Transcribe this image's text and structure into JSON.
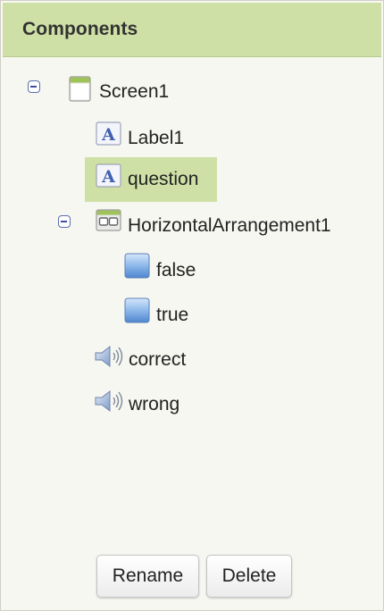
{
  "panel": {
    "title": "Components"
  },
  "tree": {
    "screen": {
      "label": "Screen1",
      "icon": "screen-icon",
      "expanded": true
    },
    "label1": {
      "label": "Label1",
      "icon": "label-icon"
    },
    "question": {
      "label": "question",
      "icon": "label-icon",
      "selected": true
    },
    "arrangement": {
      "label": "HorizontalArrangement1",
      "icon": "horizontal-arrangement-icon",
      "expanded": true
    },
    "false_button": {
      "label": "false",
      "icon": "button-icon"
    },
    "true_button": {
      "label": "true",
      "icon": "button-icon"
    },
    "correct_sound": {
      "label": "correct",
      "icon": "sound-icon"
    },
    "wrong_sound": {
      "label": "wrong",
      "icon": "sound-icon"
    }
  },
  "actions": {
    "rename_label": "Rename",
    "delete_label": "Delete"
  },
  "colors": {
    "header_bg": "#cfe0a6",
    "selected_bg": "#cfe0a6",
    "panel_bg": "#f7f7f1"
  }
}
